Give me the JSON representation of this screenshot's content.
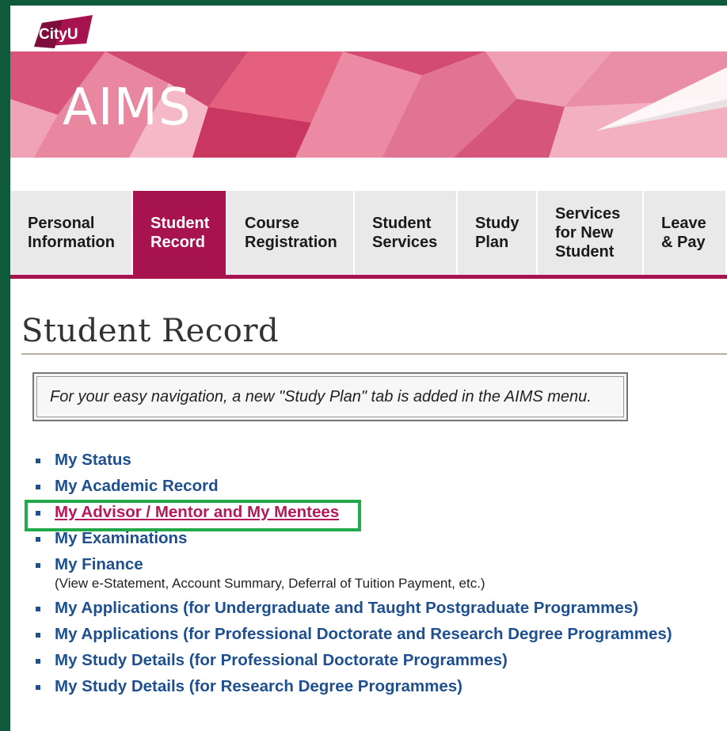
{
  "logo": {
    "text": "CityU"
  },
  "banner": {
    "title": "AIMS"
  },
  "nav": {
    "tabs": [
      {
        "label": "Personal\nInformation",
        "active": false
      },
      {
        "label": "Student\nRecord",
        "active": true
      },
      {
        "label": "Course\nRegistration",
        "active": false
      },
      {
        "label": "Student\nServices",
        "active": false
      },
      {
        "label": "Study\nPlan",
        "active": false
      },
      {
        "label": "Services\nfor   New\nStudent",
        "active": false
      },
      {
        "label": "Leave\n& Pay",
        "active": false
      }
    ]
  },
  "page": {
    "title": "Student Record",
    "notice": "For your easy navigation, a new \"Study Plan\" tab is added in the AIMS menu."
  },
  "links": [
    {
      "label": "My Status"
    },
    {
      "label": "My Academic Record"
    },
    {
      "label": "My Advisor / Mentor and My Mentees",
      "highlighted": true
    },
    {
      "label": "My Examinations"
    },
    {
      "label": "My Finance",
      "sub": "(View e-Statement, Account Summary, Deferral of Tuition Payment, etc.)"
    },
    {
      "label": "My Applications (for Undergraduate and Taught Postgraduate Programmes)"
    },
    {
      "label": "My Applications (for Professional Doctorate and Research Degree Programmes)"
    },
    {
      "label": "My Study Details (for Professional Doctorate Programmes)"
    },
    {
      "label": "My Study Details (for Research Degree Programmes)"
    }
  ],
  "colors": {
    "brand": "#a6134f",
    "link": "#1e4f8f",
    "highlight_link": "#b5195b",
    "highlight_box": "#21a94a"
  }
}
